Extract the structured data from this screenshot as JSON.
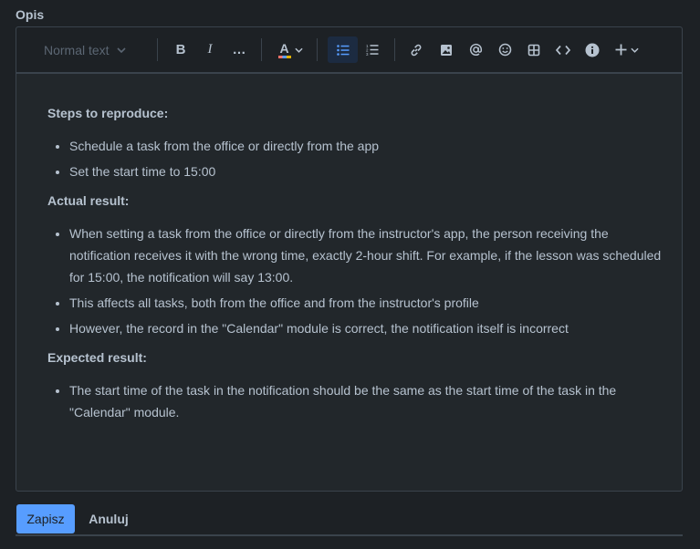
{
  "field": {
    "label": "Opis"
  },
  "toolbar": {
    "text_style": "Normal text",
    "items": [
      {
        "name": "bold",
        "label": "B"
      },
      {
        "name": "italic",
        "label": "I"
      },
      {
        "name": "more-formatting",
        "label": "…"
      },
      {
        "name": "text-color",
        "label": "A"
      }
    ]
  },
  "content": {
    "sections": [
      {
        "heading": "Steps to reproduce:",
        "items": [
          "Schedule a task from the office or directly from the app",
          "Set the start time to 15:00"
        ]
      },
      {
        "heading": "Actual result:",
        "items": [
          "When setting a task from the office or directly from the instructor's app, the person receiving the notification receives it with the wrong time, exactly 2-hour shift. For example, if the lesson was scheduled for 15:00, the notification will say 13:00.",
          "This affects all tasks, both from the office and from the instructor's profile",
          "However, the record in the \"Calendar\" module is correct, the notification itself is incorrect"
        ]
      },
      {
        "heading": "Expected result:",
        "items": [
          "The start time of the task in the notification should be the same as the start time of the task in the \"Calendar\" module."
        ]
      }
    ]
  },
  "actions": {
    "save_label": "Zapisz",
    "cancel_label": "Anuluj"
  },
  "colors": {
    "background": "#1d2125",
    "editor_bg": "#22272b",
    "accent": "#579dff",
    "active_toggle": "#1c2b41",
    "text": "#b6c2cf"
  }
}
